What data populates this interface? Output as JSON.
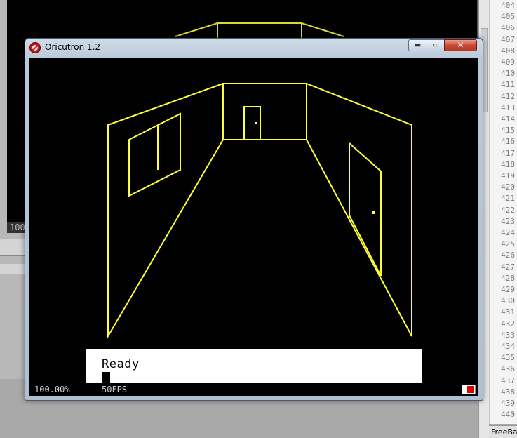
{
  "window": {
    "title": "Oricutron 1.2",
    "minimize_label": "▬",
    "maximize_label": "▭",
    "close_label": "✕"
  },
  "screen": {
    "ready_text": "Ready",
    "line_color": "#ffff33",
    "background_color": "#000000",
    "text_area_color": "#ffffff"
  },
  "statusbar": {
    "zoom": "100.00%",
    "separator": "-",
    "fps": "50FPS",
    "led_color": "#e00000"
  },
  "background_window": {
    "zoom_fragment": "100"
  },
  "gutter": {
    "line_numbers": [
      "404",
      "405",
      "406",
      "407",
      "408",
      "409",
      "410",
      "411",
      "412",
      "413",
      "414",
      "415",
      "416",
      "417",
      "418",
      "419",
      "420",
      "421",
      "422",
      "423",
      "424",
      "425",
      "426",
      "427",
      "428",
      "429",
      "430",
      "431",
      "432",
      "433",
      "434",
      "435",
      "436",
      "437",
      "438",
      "439",
      "440"
    ]
  },
  "taskbar": {
    "label": "FreeBa"
  }
}
